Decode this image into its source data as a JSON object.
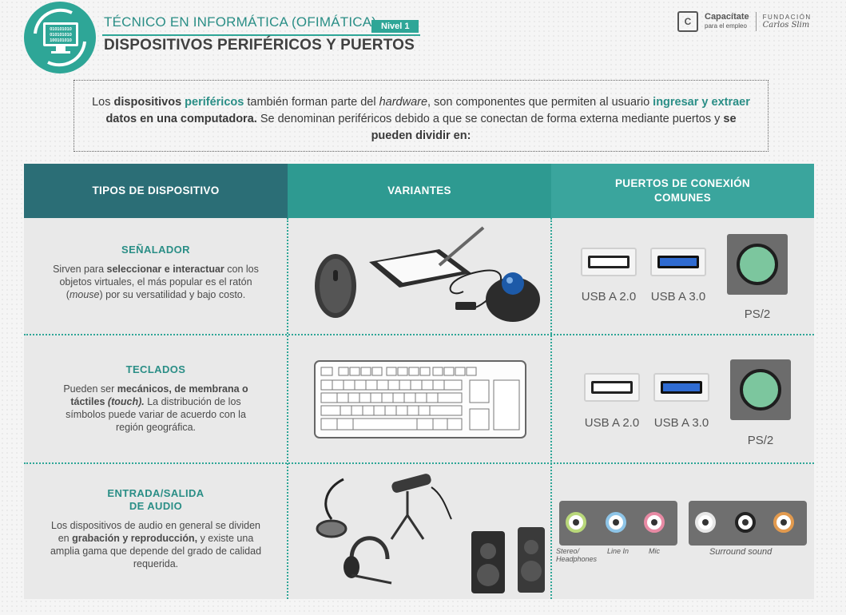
{
  "header": {
    "course": "TÉCNICO EN INFORMÁTICA (OFIMÁTICA)",
    "level": "Nivel 1",
    "title": "DISPOSITIVOS PERIFÉRICOS Y PUERTOS",
    "logo_binary": [
      "010101010",
      "010101010",
      "100101010"
    ],
    "brand_name": "Capacítate",
    "brand_sub": "para el empleo",
    "foundation": "FUNDACIÓN",
    "foundation_name": "Carlos Slim"
  },
  "intro": {
    "p1": "Los ",
    "p2": "dispositivos",
    "p3": " ",
    "p4": "periféricos",
    "p5": " también forman parte del ",
    "p6": "hardware",
    "p7": ", son componentes que permiten al usuario ",
    "p8": "ingresar y extraer",
    "p9": " ",
    "p10": "datos en una computadora.",
    "p11": " Se denominan periféricos debido a que se conectan de forma externa mediante puertos y ",
    "p12": "se pueden dividir en:"
  },
  "table": {
    "headers": [
      "TIPOS DE DISPOSITIVO",
      "VARIANTES",
      "PUERTOS DE CONEXIÓN COMUNES"
    ],
    "colors": {
      "col1": "#2b6e76",
      "col2": "#2e9a91",
      "col3": "#3aa59d"
    },
    "rows": [
      {
        "title": "SEÑALADOR",
        "t1": "Sirven para ",
        "t2": "seleccionar e interactuar",
        "t3": " con los objetos virtuales, el más popular es el ratón (",
        "t4": "mouse",
        "t5": ") por su versatilidad y bajo costo.",
        "ports": [
          "USB A 2.0",
          "USB A 3.0",
          "PS/2"
        ]
      },
      {
        "title": "TECLADOS",
        "t1": "Pueden ser ",
        "t2": "mecánicos, de membrana o táctiles",
        "t3": " ",
        "t4": "(touch).",
        "t5": " La distribución de los símbolos puede variar de acuerdo con la región geográfica.",
        "ports": [
          "USB A 2.0",
          "USB A 3.0",
          "PS/2"
        ]
      },
      {
        "title": "ENTRADA/SALIDA DE AUDIO",
        "t1": "Los dispositivos de audio en general se dividen en ",
        "t2": "grabación y reproducción,",
        "t3": " y existe una amplia gama que depende del grado de calidad requerida.",
        "audio_labels": [
          "Stereo/ Headphones",
          "Line In",
          "Mic",
          "Surround sound"
        ]
      }
    ]
  },
  "accent": "#2ea697"
}
